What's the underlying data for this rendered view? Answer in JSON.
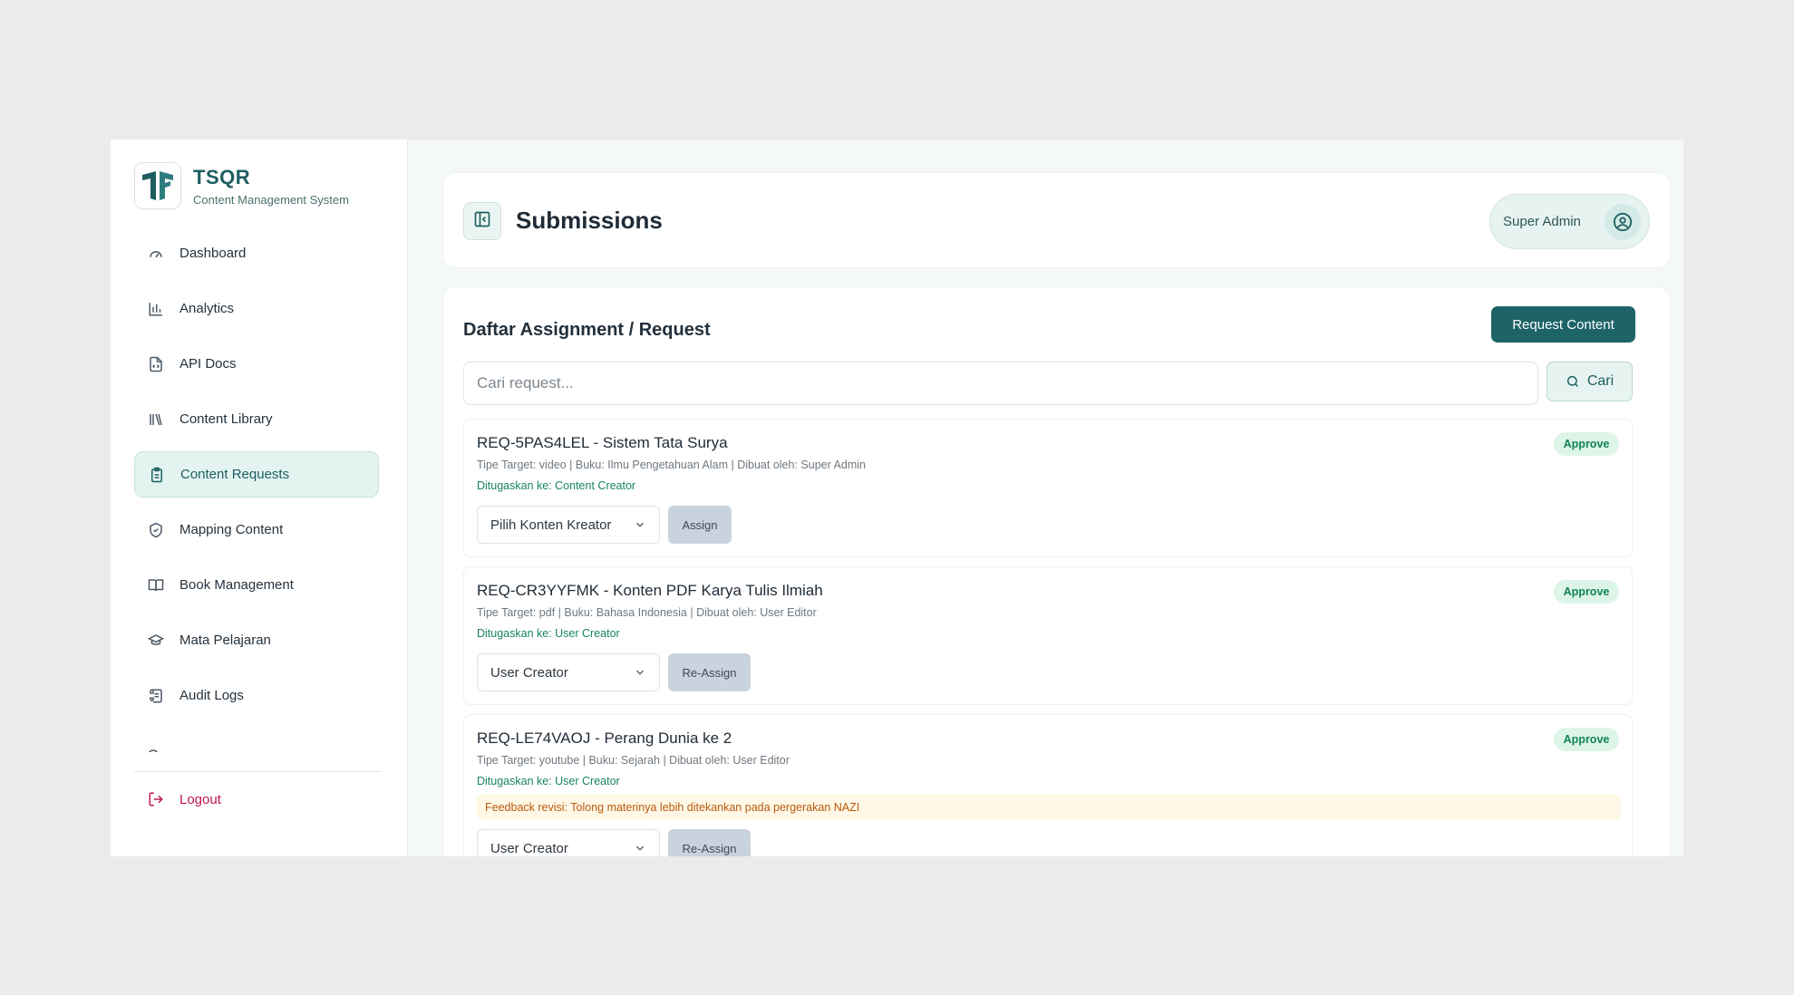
{
  "brand": {
    "title": "TSQR",
    "subtitle": "Content Management System"
  },
  "sidebar": {
    "items": [
      {
        "label": "Dashboard",
        "icon": "gauge-icon"
      },
      {
        "label": "Analytics",
        "icon": "bar-chart-icon"
      },
      {
        "label": "API Docs",
        "icon": "file-code-icon"
      },
      {
        "label": "Content Library",
        "icon": "library-icon"
      },
      {
        "label": "Content Requests",
        "icon": "clipboard-icon",
        "active": true
      },
      {
        "label": "Mapping Content",
        "icon": "shield-check-icon"
      },
      {
        "label": "Book Management",
        "icon": "book-open-icon"
      },
      {
        "label": "Mata Pelajaran",
        "icon": "graduation-cap-icon"
      },
      {
        "label": "Audit Logs",
        "icon": "scroll-icon"
      }
    ],
    "logout_label": "Logout"
  },
  "header": {
    "title": "Submissions",
    "user_name": "Super Admin"
  },
  "panel": {
    "title": "Daftar Assignment / Request",
    "request_button": "Request Content",
    "search_placeholder": "Cari request...",
    "search_button": "Cari"
  },
  "requests": [
    {
      "title": "REQ-5PAS4LEL - Sistem Tata Surya",
      "meta": "Tipe Target: video | Buku: Ilmu Pengetahuan Alam | Dibuat oleh: Super Admin",
      "assigned": "Ditugaskan ke: Content Creator",
      "status": "Approve",
      "select_value": "Pilih Konten Kreator",
      "action": "Assign"
    },
    {
      "title": "REQ-CR3YYFMK - Konten PDF Karya Tulis Ilmiah",
      "meta": "Tipe Target: pdf | Buku: Bahasa Indonesia | Dibuat oleh: User Editor",
      "assigned": "Ditugaskan ke: User Creator",
      "status": "Approve",
      "select_value": "User Creator",
      "action": "Re-Assign"
    },
    {
      "title": "REQ-LE74VAOJ - Perang Dunia ke 2",
      "meta": "Tipe Target: youtube | Buku: Sejarah | Dibuat oleh: User Editor",
      "assigned": "Ditugaskan ke: User Creator",
      "feedback": "Feedback revisi: Tolong materinya lebih ditekankan pada pergerakan NAZI",
      "status": "Approve",
      "select_value": "User Creator",
      "action": "Re-Assign"
    }
  ],
  "colors": {
    "brand": "#1e6467",
    "accent_bg": "#e3f3f0",
    "approve_bg": "#dcf5e8",
    "approve_text": "#128453",
    "logout": "#c0184a",
    "feedback_bg": "#fff8e6"
  }
}
